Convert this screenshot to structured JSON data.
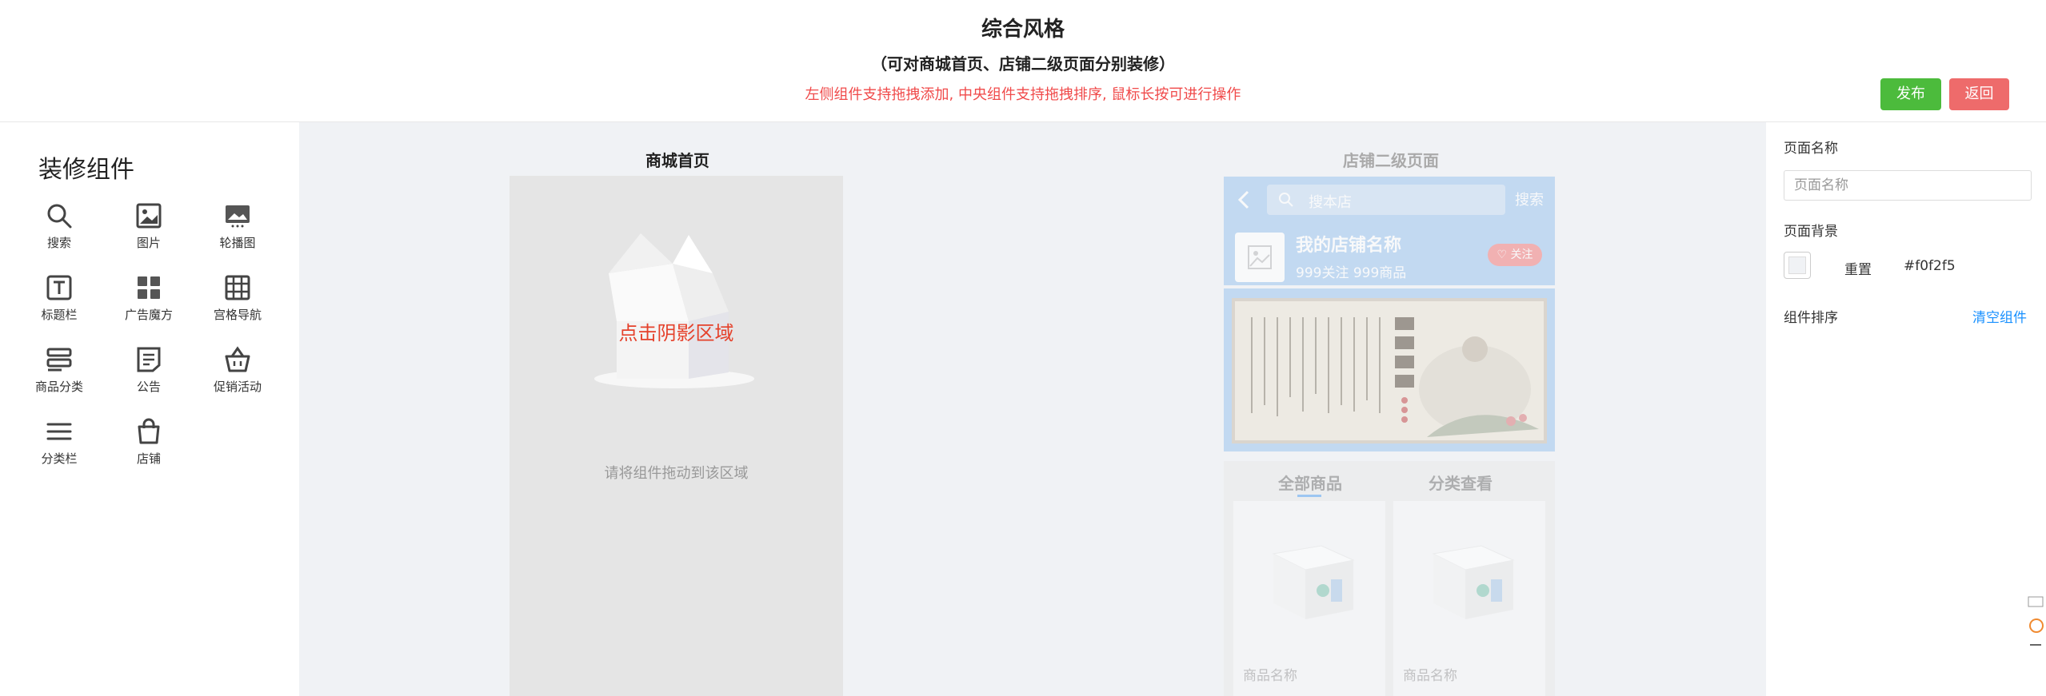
{
  "header": {
    "title": "综合风格",
    "subtitle": "（可对商城首页、店铺二级页面分别装修）",
    "hint": "左侧组件支持拖拽添加, 中央组件支持拖拽排序, 鼠标长按可进行操作",
    "publish_label": "发布",
    "back_label": "返回"
  },
  "sidebar": {
    "title": "装修组件",
    "items": [
      {
        "label": "搜索",
        "icon": "search-icon"
      },
      {
        "label": "图片",
        "icon": "image-icon"
      },
      {
        "label": "轮播图",
        "icon": "carousel-icon"
      },
      {
        "label": "标题栏",
        "icon": "title-bar-icon"
      },
      {
        "label": "广告魔方",
        "icon": "ad-cube-icon"
      },
      {
        "label": "宫格导航",
        "icon": "grid-nav-icon"
      },
      {
        "label": "商品分类",
        "icon": "category-icon"
      },
      {
        "label": "公告",
        "icon": "notice-icon"
      },
      {
        "label": "促销活动",
        "icon": "basket-icon"
      },
      {
        "label": "分类栏",
        "icon": "menu-icon"
      },
      {
        "label": "店铺",
        "icon": "shop-bag-icon"
      }
    ]
  },
  "canvas": {
    "home_title": "商城首页",
    "home_shadow_text": "点击阴影区域",
    "home_drop_text": "请将组件拖动到该区域",
    "store_title": "店铺二级页面",
    "store": {
      "search_placeholder": "搜本店",
      "search_button": "搜索",
      "shop_name": "我的店铺名称",
      "shop_stats": "999关注 999商品",
      "follow_label": "关注",
      "tabs": [
        "全部商品",
        "分类查看"
      ],
      "products": [
        "商品名称",
        "商品名称"
      ]
    }
  },
  "panel": {
    "page_name_label": "页面名称",
    "page_name_placeholder": "页面名称",
    "page_bg_label": "页面背景",
    "reset_label": "重置",
    "bg_value": "#f0f2f5",
    "sort_label": "组件排序",
    "clear_label": "清空组件"
  },
  "colors": {
    "publish": "#4cbb3c",
    "back": "#ee6b6b",
    "hint": "#f04a4a",
    "link": "#1890ff",
    "canvas_bg": "#f0f2f5"
  }
}
